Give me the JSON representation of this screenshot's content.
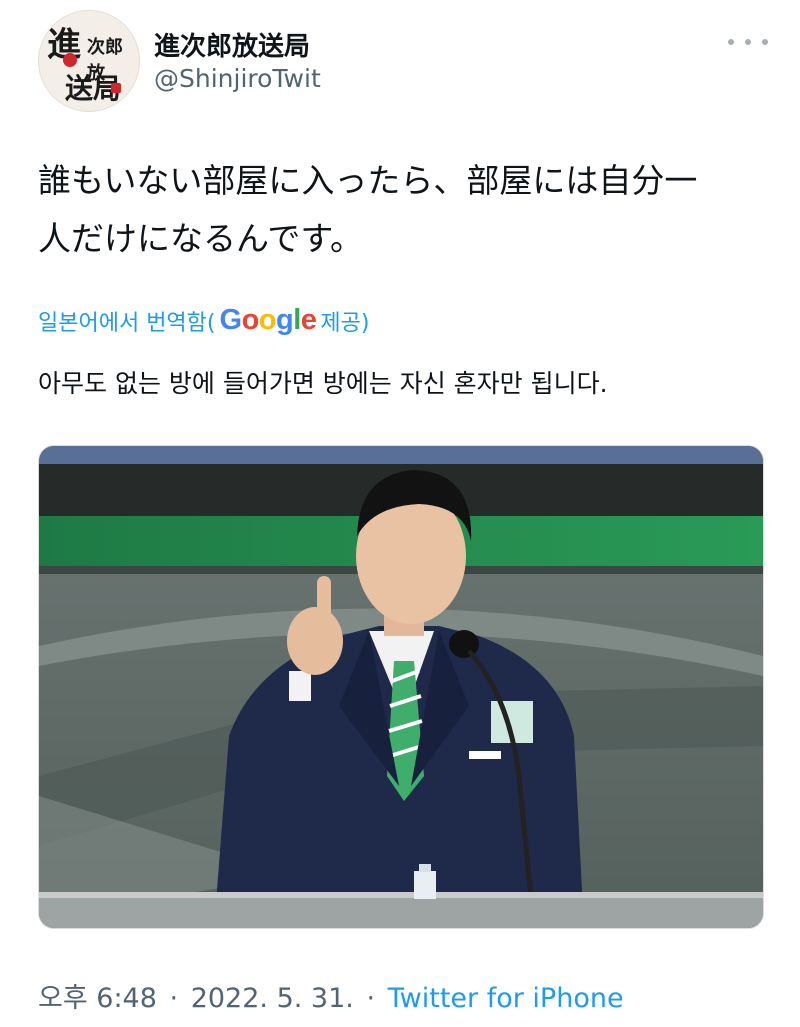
{
  "author": {
    "display_name": "進次郎放送局",
    "handle": "@ShinjiroTwit",
    "avatar_text": "進次郎放送局"
  },
  "tweet": {
    "text_line1": "誰もいない部屋に入ったら、部屋には自分一",
    "text_line2": "人だけになるんです。"
  },
  "translation": {
    "label_prefix": "일본어에서 번역함(",
    "google_g1": "G",
    "google_o1": "o",
    "google_o2": "o",
    "google_g2": "g",
    "google_l": "l",
    "google_e": "e",
    "label_suffix": " 제공)",
    "text": "아무도 없는 방에 들어가면 방에는 자신 혼자만 됩니다."
  },
  "media": {
    "description_icon": "photo"
  },
  "footer": {
    "time": "오후 6:48",
    "separator": "·",
    "date": "2022. 5. 31.",
    "source": "Twitter for iPhone"
  },
  "colors": {
    "link": "#1d9bf0",
    "secondary_text": "#536471",
    "primary_text": "#0f1419"
  }
}
